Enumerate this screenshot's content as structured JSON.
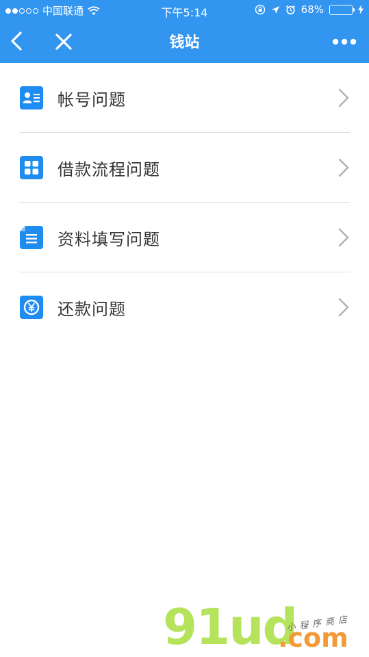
{
  "status_bar": {
    "carrier": "中国联通",
    "time": "下午5:14",
    "battery": "68%",
    "battery_fill": 0.68
  },
  "nav": {
    "title": "钱站"
  },
  "menu": {
    "items": [
      {
        "label": "帐号问题",
        "icon": "id-card-icon"
      },
      {
        "label": "借款流程问题",
        "icon": "grid-icon"
      },
      {
        "label": "资料填写问题",
        "icon": "document-icon"
      },
      {
        "label": "还款问题",
        "icon": "yen-coin-icon"
      }
    ]
  },
  "watermark": {
    "brand": "91ud",
    "domain": ".com",
    "tagline": "小程序商店"
  },
  "colors": {
    "header": "#3295f0",
    "icon": "#1e8cf0",
    "separator": "#dcdcdc",
    "chevron": "#b0b0b0"
  }
}
